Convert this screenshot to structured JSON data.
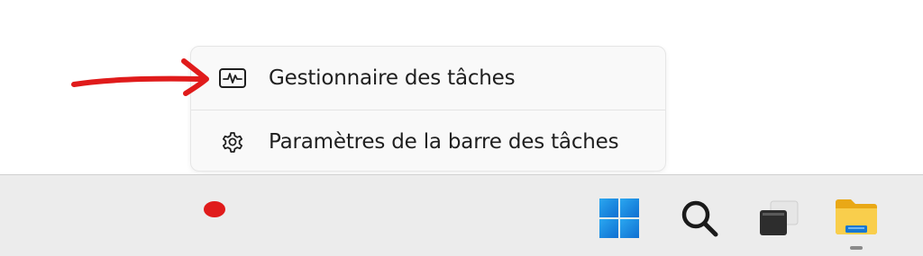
{
  "context_menu": {
    "items": [
      {
        "label": "Gestionnaire des tâches",
        "icon": "task-manager-icon"
      },
      {
        "label": "Paramètres de la barre des tâches",
        "icon": "gear-icon"
      }
    ]
  },
  "taskbar": {
    "buttons": [
      {
        "name": "start",
        "icon": "windows-logo-icon"
      },
      {
        "name": "search",
        "icon": "search-icon"
      },
      {
        "name": "task-view",
        "icon": "task-view-icon"
      },
      {
        "name": "file-explorer",
        "icon": "folder-icon",
        "running": true
      }
    ]
  },
  "annotations": {
    "color": "#e01b1b",
    "marks": [
      "arrow",
      "dot"
    ]
  },
  "colors": {
    "windows_blue": "#1a8fe3",
    "folder_yellow": "#f7c948",
    "menu_background": "#f9f9f9",
    "taskbar_background": "#ececec"
  }
}
